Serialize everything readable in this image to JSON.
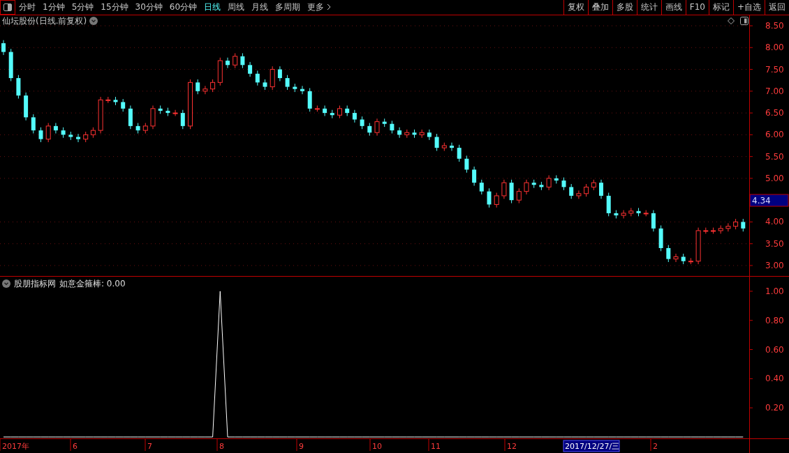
{
  "toolbar": {
    "periods": [
      {
        "label": "分时",
        "selected": false
      },
      {
        "label": "1分钟",
        "selected": false
      },
      {
        "label": "5分钟",
        "selected": false
      },
      {
        "label": "15分钟",
        "selected": false
      },
      {
        "label": "30分钟",
        "selected": false
      },
      {
        "label": "60分钟",
        "selected": false
      },
      {
        "label": "日线",
        "selected": true
      },
      {
        "label": "周线",
        "selected": false
      },
      {
        "label": "月线",
        "selected": false
      },
      {
        "label": "多周期",
        "selected": false
      },
      {
        "label": "更多",
        "selected": false
      }
    ],
    "buttons": [
      "复权",
      "叠加",
      "多股",
      "统计",
      "画线",
      "F10",
      "标记",
      "+自选",
      "返回"
    ]
  },
  "price_panel": {
    "title": "仙坛股份(日线.前复权)",
    "last_price": "4.34",
    "chart_data": {
      "type": "candlestick",
      "ylim": [
        2.76,
        8.74
      ],
      "grid": true,
      "yticks": [
        {
          "value": 3,
          "label": "3.00"
        },
        {
          "value": 3.5,
          "label": "3.50"
        },
        {
          "value": 4,
          "label": "4.00"
        },
        {
          "value": 5,
          "label": "5.00"
        },
        {
          "value": 5.5,
          "label": "5.50"
        },
        {
          "value": 6,
          "label": "6.00"
        },
        {
          "value": 6.5,
          "label": "6.50"
        },
        {
          "value": 7,
          "label": "7.00"
        },
        {
          "value": 7.5,
          "label": "7.50"
        },
        {
          "value": 8,
          "label": "8.00"
        },
        {
          "value": 8.5,
          "label": "8.50"
        }
      ],
      "ohlc": [
        [
          8.1,
          8.17,
          7.83,
          7.9
        ],
        [
          7.9,
          7.97,
          7.23,
          7.3
        ],
        [
          7.3,
          7.37,
          6.83,
          6.9
        ],
        [
          6.9,
          6.97,
          6.33,
          6.4
        ],
        [
          6.4,
          6.47,
          6.03,
          6.1
        ],
        [
          6.1,
          6.17,
          5.83,
          5.9
        ],
        [
          5.9,
          6.27,
          5.83,
          6.2
        ],
        [
          6.2,
          6.27,
          6.03,
          6.1
        ],
        [
          6.1,
          6.17,
          5.93,
          6.0
        ],
        [
          6.0,
          6.07,
          5.88,
          5.95
        ],
        [
          5.95,
          6.02,
          5.83,
          5.9
        ],
        [
          5.9,
          6.07,
          5.83,
          6.0
        ],
        [
          6.0,
          6.17,
          5.93,
          6.1
        ],
        [
          6.1,
          6.87,
          6.03,
          6.8
        ],
        [
          6.8,
          6.87,
          6.73,
          6.8
        ],
        [
          6.8,
          6.87,
          6.68,
          6.75
        ],
        [
          6.75,
          6.82,
          6.53,
          6.6
        ],
        [
          6.6,
          6.67,
          6.13,
          6.2
        ],
        [
          6.2,
          6.27,
          6.03,
          6.1
        ],
        [
          6.1,
          6.27,
          6.03,
          6.2
        ],
        [
          6.2,
          6.67,
          6.13,
          6.6
        ],
        [
          6.6,
          6.67,
          6.48,
          6.55
        ],
        [
          6.55,
          6.62,
          6.43,
          6.5
        ],
        [
          6.5,
          6.57,
          6.43,
          6.5
        ],
        [
          6.5,
          6.57,
          6.13,
          6.2
        ],
        [
          6.2,
          7.27,
          6.13,
          7.2
        ],
        [
          7.2,
          7.27,
          6.93,
          7.0
        ],
        [
          7.0,
          7.12,
          6.93,
          7.05
        ],
        [
          7.05,
          7.27,
          6.98,
          7.2
        ],
        [
          7.2,
          7.77,
          7.13,
          7.7
        ],
        [
          7.7,
          7.77,
          7.53,
          7.6
        ],
        [
          7.6,
          7.87,
          7.53,
          7.8
        ],
        [
          7.8,
          7.87,
          7.53,
          7.6
        ],
        [
          7.6,
          7.67,
          7.33,
          7.4
        ],
        [
          7.4,
          7.47,
          7.13,
          7.2
        ],
        [
          7.2,
          7.27,
          7.03,
          7.1
        ],
        [
          7.1,
          7.57,
          7.03,
          7.5
        ],
        [
          7.5,
          7.57,
          7.23,
          7.3
        ],
        [
          7.3,
          7.37,
          7.03,
          7.1
        ],
        [
          7.1,
          7.17,
          6.98,
          7.05
        ],
        [
          7.05,
          7.12,
          6.93,
          7.0
        ],
        [
          7.0,
          7.07,
          6.53,
          6.6
        ],
        [
          6.6,
          6.67,
          6.53,
          6.6
        ],
        [
          6.6,
          6.67,
          6.43,
          6.5
        ],
        [
          6.5,
          6.57,
          6.38,
          6.45
        ],
        [
          6.45,
          6.67,
          6.38,
          6.6
        ],
        [
          6.6,
          6.67,
          6.43,
          6.5
        ],
        [
          6.5,
          6.57,
          6.28,
          6.35
        ],
        [
          6.35,
          6.42,
          6.13,
          6.2
        ],
        [
          6.2,
          6.27,
          5.98,
          6.05
        ],
        [
          6.05,
          6.37,
          5.98,
          6.3
        ],
        [
          6.3,
          6.37,
          6.18,
          6.25
        ],
        [
          6.25,
          6.32,
          6.03,
          6.1
        ],
        [
          6.1,
          6.17,
          5.93,
          6.0
        ],
        [
          6.0,
          6.12,
          5.93,
          6.05
        ],
        [
          6.05,
          6.12,
          5.93,
          6.0
        ],
        [
          6.0,
          6.12,
          5.93,
          6.05
        ],
        [
          6.05,
          6.12,
          5.88,
          5.95
        ],
        [
          5.95,
          6.02,
          5.63,
          5.7
        ],
        [
          5.7,
          5.82,
          5.63,
          5.75
        ],
        [
          5.75,
          5.82,
          5.63,
          5.7
        ],
        [
          5.7,
          5.77,
          5.38,
          5.45
        ],
        [
          5.45,
          5.52,
          5.13,
          5.2
        ],
        [
          5.2,
          5.27,
          4.83,
          4.9
        ],
        [
          4.9,
          4.97,
          4.63,
          4.7
        ],
        [
          4.7,
          4.77,
          4.33,
          4.4
        ],
        [
          4.4,
          4.67,
          4.33,
          4.6
        ],
        [
          4.6,
          4.97,
          4.53,
          4.9
        ],
        [
          4.9,
          4.97,
          4.43,
          4.5
        ],
        [
          4.5,
          4.77,
          4.43,
          4.7
        ],
        [
          4.7,
          4.97,
          4.63,
          4.9
        ],
        [
          4.9,
          4.97,
          4.78,
          4.85
        ],
        [
          4.85,
          4.92,
          4.73,
          4.8
        ],
        [
          4.8,
          5.07,
          4.73,
          5.0
        ],
        [
          5.0,
          5.07,
          4.88,
          4.95
        ],
        [
          4.95,
          5.02,
          4.73,
          4.8
        ],
        [
          4.8,
          4.87,
          4.53,
          4.6
        ],
        [
          4.6,
          4.72,
          4.53,
          4.65
        ],
        [
          4.65,
          4.87,
          4.58,
          4.8
        ],
        [
          4.8,
          4.97,
          4.73,
          4.9
        ],
        [
          4.9,
          4.97,
          4.53,
          4.6
        ],
        [
          4.6,
          4.67,
          4.13,
          4.2
        ],
        [
          4.2,
          4.27,
          4.08,
          4.15
        ],
        [
          4.15,
          4.27,
          4.08,
          4.2
        ],
        [
          4.2,
          4.32,
          4.13,
          4.25
        ],
        [
          4.25,
          4.32,
          4.13,
          4.2
        ],
        [
          4.2,
          4.27,
          4.13,
          4.2
        ],
        [
          4.2,
          4.27,
          3.78,
          3.85
        ],
        [
          3.85,
          3.92,
          3.33,
          3.4
        ],
        [
          3.4,
          3.47,
          3.08,
          3.15
        ],
        [
          3.15,
          3.27,
          3.08,
          3.2
        ],
        [
          3.2,
          3.27,
          3.03,
          3.1
        ],
        [
          3.1,
          3.17,
          3.03,
          3.1
        ],
        [
          3.1,
          3.87,
          3.03,
          3.8
        ],
        [
          3.8,
          3.87,
          3.73,
          3.8
        ],
        [
          3.8,
          3.87,
          3.73,
          3.8
        ],
        [
          3.8,
          3.92,
          3.73,
          3.85
        ],
        [
          3.85,
          3.97,
          3.78,
          3.9
        ],
        [
          3.9,
          4.07,
          3.83,
          4.0
        ],
        [
          4.0,
          4.07,
          3.78,
          3.85
        ]
      ]
    }
  },
  "indicator_panel": {
    "name": "股朋指标网",
    "reading": "如意金箍棒: 0.00",
    "chart_data": {
      "type": "line",
      "ylim": [
        0,
        1.1
      ],
      "yticks": [
        {
          "value": 0.2,
          "label": "0.20"
        },
        {
          "value": 0.4,
          "label": "0.40"
        },
        {
          "value": 0.6,
          "label": "0.60"
        },
        {
          "value": 0.8,
          "label": "0.80"
        },
        {
          "value": 1,
          "label": "1.00"
        }
      ],
      "series": [
        {
          "color": "#ffffff",
          "values": [
            0,
            0,
            0,
            0,
            0,
            0,
            0,
            0,
            0,
            0,
            0,
            0,
            0,
            0,
            0,
            0,
            0,
            0,
            0,
            0,
            0,
            0,
            0,
            0,
            0,
            0,
            0,
            0,
            0,
            1,
            0,
            0,
            0,
            0,
            0,
            0,
            0,
            0,
            0,
            0,
            0,
            0,
            0,
            0,
            0,
            0,
            0,
            0,
            0,
            0,
            0,
            0,
            0,
            0,
            0,
            0,
            0,
            0,
            0,
            0,
            0,
            0,
            0,
            0,
            0,
            0,
            0,
            0,
            0,
            0,
            0,
            0,
            0,
            0,
            0,
            0,
            0,
            0,
            0,
            0,
            0,
            0,
            0,
            0,
            0,
            0,
            0,
            0,
            0,
            0,
            0,
            0,
            0,
            0,
            0,
            0,
            0,
            0,
            0,
            0
          ]
        }
      ]
    }
  },
  "date_axis": [
    {
      "label": "2017年",
      "selected": false
    },
    {
      "label": "6",
      "selected": false
    },
    {
      "label": "7",
      "selected": false
    },
    {
      "label": "8",
      "selected": false
    },
    {
      "label": "9",
      "selected": false
    },
    {
      "label": "10",
      "selected": false
    },
    {
      "label": "11",
      "selected": false
    },
    {
      "label": "12",
      "selected": false
    },
    {
      "label": "2017/12/27/三",
      "selected": true
    },
    {
      "label": "2",
      "selected": false
    }
  ]
}
